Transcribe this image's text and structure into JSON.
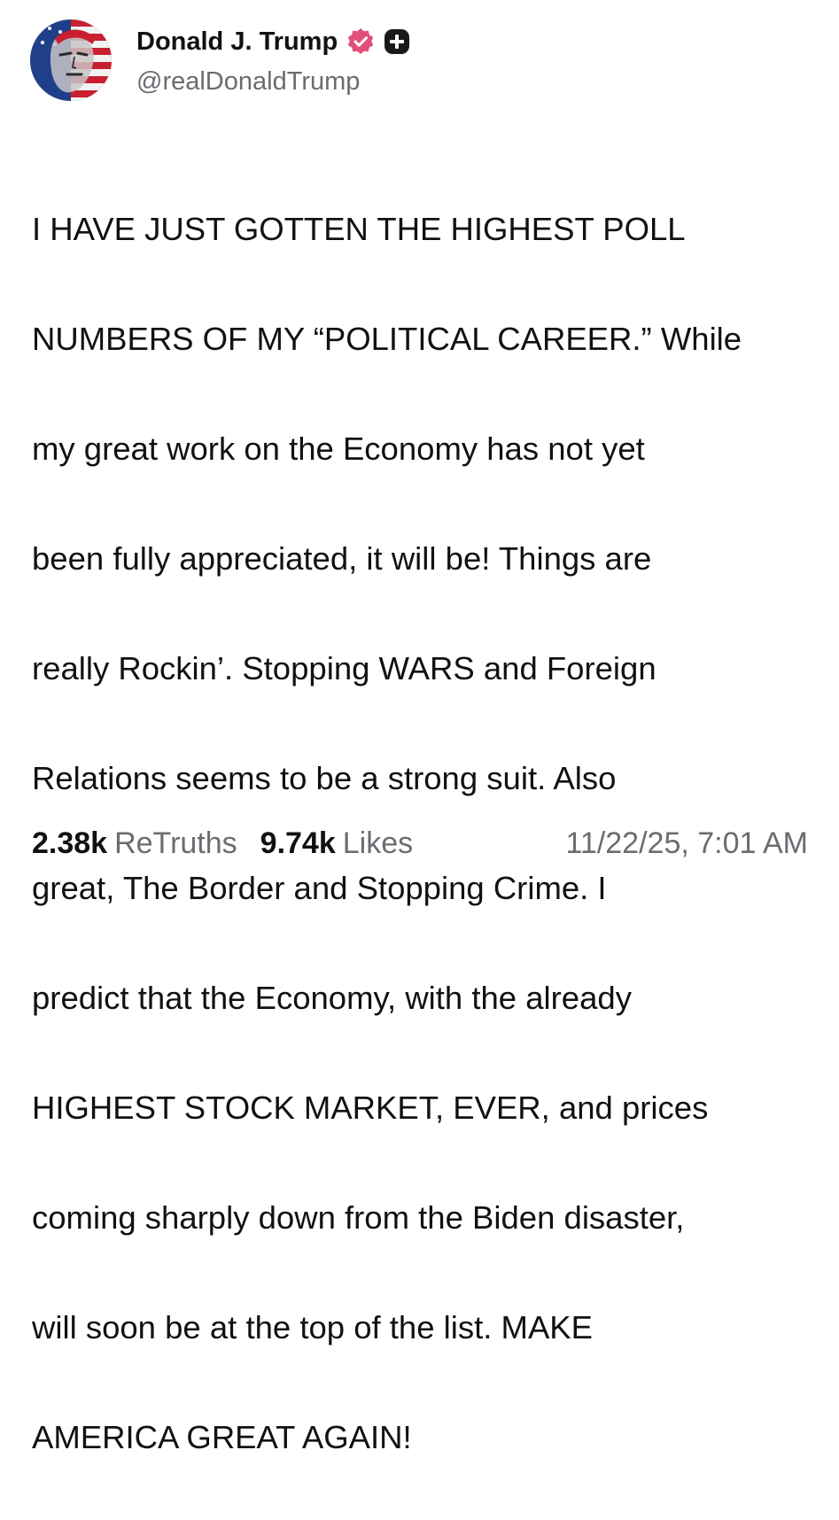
{
  "author": {
    "display_name": "Donald J. Trump",
    "handle": "@realDonaldTrump",
    "avatar_icon": "avatar-portrait-flag",
    "verified_icon": "verified-badge-icon",
    "verified_color": "#e0507a",
    "plus_icon": "plus-badge-icon"
  },
  "post": {
    "lines": [
      "I HAVE JUST GOTTEN THE HIGHEST POLL",
      "NUMBERS OF MY “POLITICAL CAREER.” While",
      "my great work on the Economy has not yet",
      "been fully appreciated, it will be! Things are",
      "really Rockin’. Stopping WARS and Foreign",
      "Relations seems to be a strong suit. Also",
      "great, The Border and Stopping Crime. I",
      "predict that the Economy, with the already",
      "HIGHEST STOCK MARKET, EVER, and prices",
      "coming sharply down from the Biden disaster,",
      "will soon be at the top of the list. MAKE",
      "AMERICA GREAT AGAIN!"
    ]
  },
  "stats": {
    "retruths_count": "2.38k",
    "retruths_label": "ReTruths",
    "likes_count": "9.74k",
    "likes_label": "Likes",
    "timestamp": "11/22/25, 7:01 AM"
  },
  "colors": {
    "text": "#111111",
    "muted": "#6b6b72",
    "background": "#ffffff"
  }
}
